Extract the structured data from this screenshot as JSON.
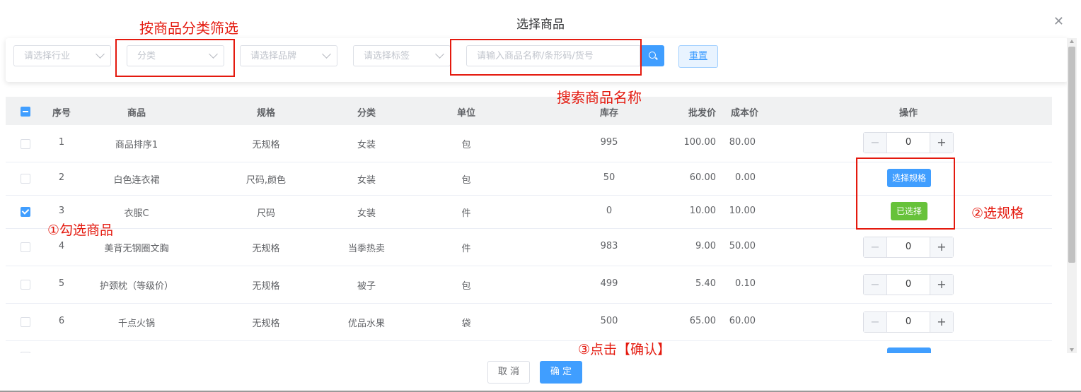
{
  "dialog": {
    "title": "选择商品"
  },
  "filters": {
    "industry_placeholder": "请选择行业",
    "category_placeholder": "分类",
    "brand_placeholder": "请选择品牌",
    "tag_placeholder": "请选择标签",
    "search_placeholder": "请输入商品名称/条形码/货号",
    "reset_label": "重置"
  },
  "table": {
    "headers": {
      "index": "序号",
      "product": "商品",
      "spec": "规格",
      "category": "分类",
      "unit": "单位",
      "stock": "库存",
      "wholesale": "批发价",
      "cost": "成本价",
      "action": "操作"
    },
    "rows": [
      {
        "index": "1",
        "product": "商品排序1",
        "spec": "无规格",
        "category": "女装",
        "unit": "包",
        "stock": "995",
        "wholesale": "100.00",
        "cost": "80.00",
        "qty": "0",
        "checked": false
      },
      {
        "index": "2",
        "product": "白色连衣裙",
        "spec": "尺码,颜色",
        "category": "女装",
        "unit": "包",
        "stock": "50",
        "wholesale": "60.00",
        "cost": "0.00",
        "action_label": "选择规格",
        "checked": false
      },
      {
        "index": "3",
        "product": "衣服C",
        "spec": "尺码",
        "category": "女装",
        "unit": "件",
        "stock": "0",
        "wholesale": "10.00",
        "cost": "10.00",
        "action_label": "已选择",
        "checked": true
      },
      {
        "index": "4",
        "product": "美背无钢圈文胸",
        "spec": "无规格",
        "category": "当季热卖",
        "unit": "件",
        "stock": "983",
        "wholesale": "9.00",
        "cost": "50.00",
        "qty": "0",
        "checked": false
      },
      {
        "index": "5",
        "product": "护颈枕（等级价）",
        "spec": "无规格",
        "category": "被子",
        "unit": "包",
        "stock": "499",
        "wholesale": "5.40",
        "cost": "0.10",
        "qty": "0",
        "checked": false
      },
      {
        "index": "6",
        "product": "千点火锅",
        "spec": "无规格",
        "category": "优品水果",
        "unit": "袋",
        "stock": "500",
        "wholesale": "65.00",
        "cost": "60.00",
        "qty": "0",
        "checked": false
      }
    ]
  },
  "footer": {
    "cancel_label": "取 消",
    "confirm_label": "确 定"
  },
  "annotations": {
    "category_filter": "按商品分类筛选",
    "search_name": "搜索商品名称",
    "check_product": "①勾选商品",
    "select_spec": "②选规格",
    "click_confirm": "③点击【确认】"
  },
  "colors": {
    "primary": "#409eff",
    "success": "#67c23a",
    "annotation_red": "#e4190e"
  }
}
